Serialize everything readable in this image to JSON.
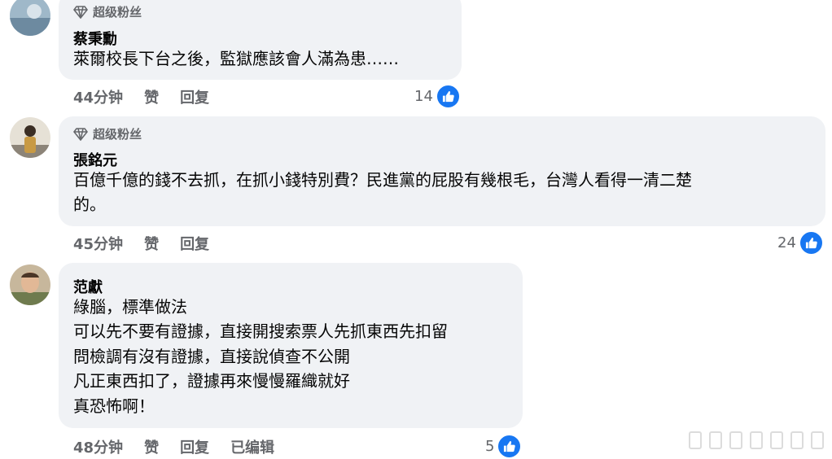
{
  "comments": [
    {
      "badge": "超级粉丝",
      "author": "蔡秉勳",
      "lines": [
        "萊爾校長下台之後，監獄應該會人滿為患……"
      ],
      "time": "44分钟",
      "like_label": "赞",
      "reply_label": "回复",
      "reactions": "14"
    },
    {
      "badge": "超级粉丝",
      "author": "張銘元",
      "lines": [
        "百億千億的錢不去抓，在抓小錢特別費？民進黨的屁股有幾根毛，台灣人看得一清二楚",
        "的。"
      ],
      "time": "45分钟",
      "like_label": "赞",
      "reply_label": "回复",
      "reactions": "24"
    },
    {
      "author": "范獻",
      "lines": [
        "綠腦，標準做法",
        "可以先不要有證據，直接開搜索票人先抓東西先扣留",
        "問檢調有沒有證據，直接說偵查不公開",
        "凡正東西扣了，證據再來慢慢羅織就好",
        "真恐怖啊！"
      ],
      "time": "48分钟",
      "like_label": "赞",
      "reply_label": "回复",
      "edited_label": "已编辑",
      "reactions": "5"
    }
  ],
  "icons": {
    "badge": "diamond-icon",
    "reaction": "thumbs-up-icon"
  },
  "colors": {
    "like_blue": "#1877f2",
    "bubble_bg": "#f0f2f5",
    "meta_gray": "#65676b"
  }
}
